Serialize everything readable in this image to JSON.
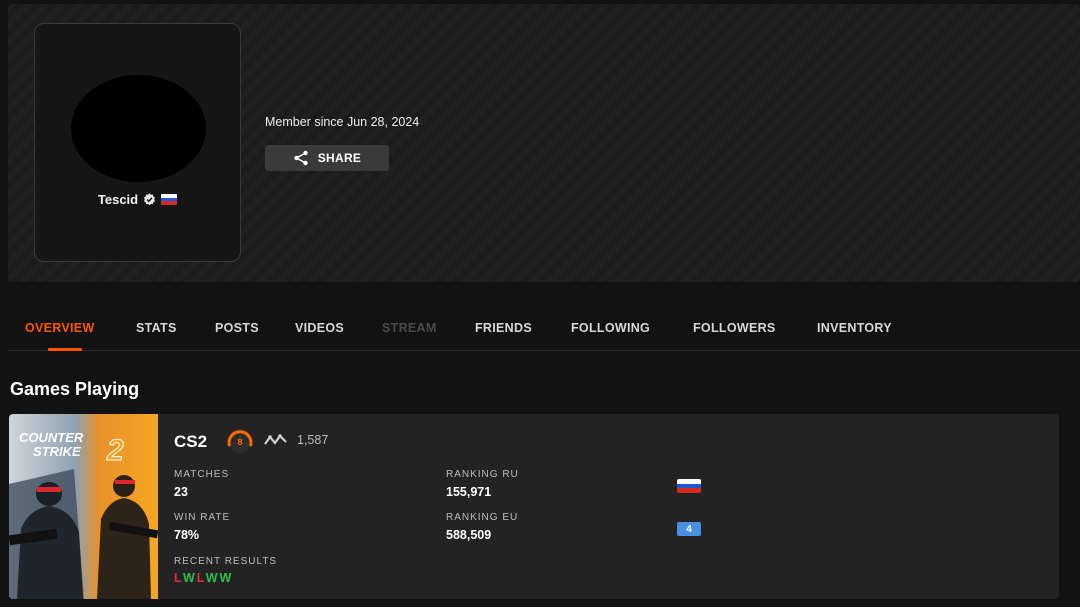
{
  "profile": {
    "nickname": "Tescid",
    "member_since": "Member since Jun 28, 2024",
    "share_label": "SHARE",
    "verified_icon": "verified-badge-icon",
    "country_flag": "russia-flag-icon"
  },
  "tabs": [
    {
      "label": "OVERVIEW",
      "state": "active"
    },
    {
      "label": "STATS",
      "state": "normal"
    },
    {
      "label": "POSTS",
      "state": "normal"
    },
    {
      "label": "VIDEOS",
      "state": "normal"
    },
    {
      "label": "STREAM",
      "state": "disabled"
    },
    {
      "label": "FRIENDS",
      "state": "normal"
    },
    {
      "label": "FOLLOWING",
      "state": "normal"
    },
    {
      "label": "FOLLOWERS",
      "state": "normal"
    },
    {
      "label": "INVENTORY",
      "state": "normal"
    }
  ],
  "games_section": {
    "title": "Games Playing",
    "game": {
      "name": "CS2",
      "cover_text": [
        "COUNTER",
        "STRIKE",
        "2"
      ],
      "skill_level": "8",
      "elo": "1,587",
      "matches_label": "MATCHES",
      "matches": "23",
      "win_rate_label": "WIN RATE",
      "win_rate": "78%",
      "ranking_country_label": "RANKING RU",
      "ranking_country": "155,971",
      "ranking_region_label": "RANKING EU",
      "ranking_region": "588,509",
      "region_flag_text": "4",
      "recent_results_label": "RECENT RESULTS",
      "recent_results": [
        "L",
        "W",
        "L",
        "W",
        "W"
      ]
    }
  },
  "colors": {
    "accent": "#ff5500",
    "win": "#2fbf4a",
    "loss": "#e0313b",
    "background": "#121212",
    "card": "#232323"
  }
}
